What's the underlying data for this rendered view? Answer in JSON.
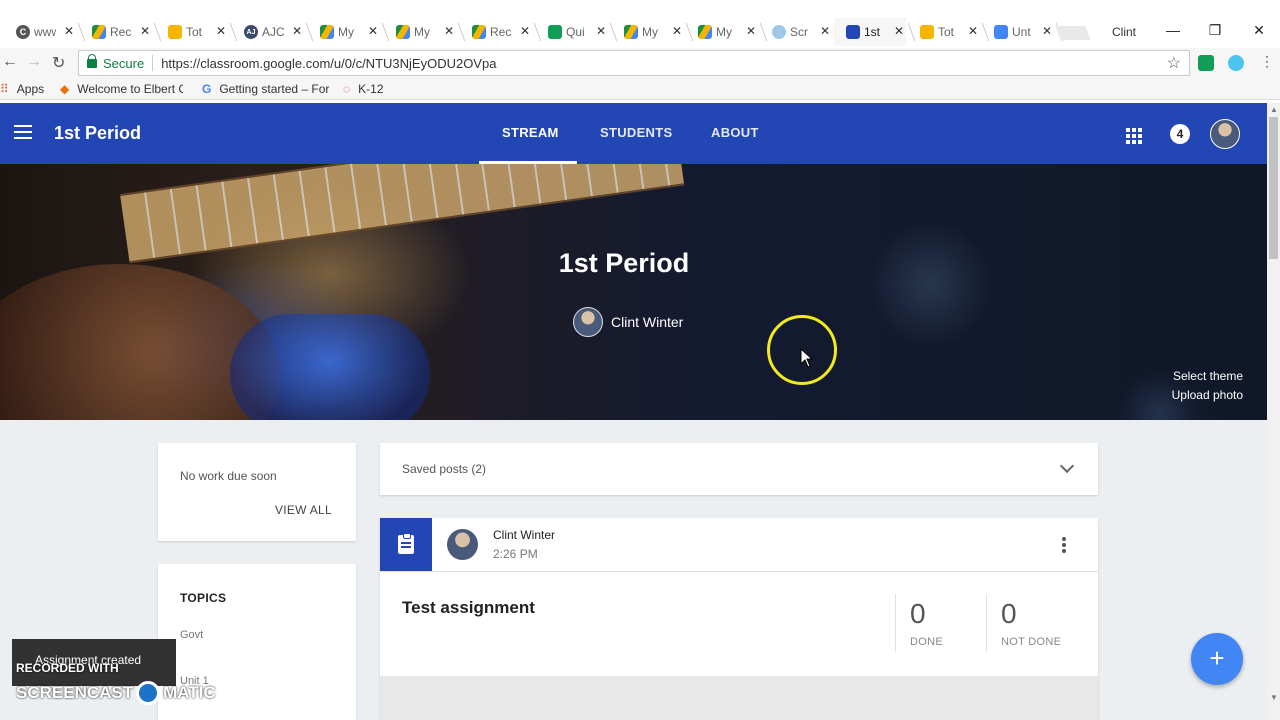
{
  "browser": {
    "tabs": [
      {
        "label": "www",
        "favicon": "C",
        "favicon_color": "#555555"
      },
      {
        "label": "Rec",
        "favicon": "",
        "favicon_color": "#1e8e3e"
      },
      {
        "label": "Tot",
        "favicon": "",
        "favicon_color": "#f4b400"
      },
      {
        "label": "AJC",
        "favicon": "AJ",
        "favicon_color": "#3c4a6b"
      },
      {
        "label": "My",
        "favicon": "",
        "favicon_color": "#1e8e3e"
      },
      {
        "label": "My",
        "favicon": "",
        "favicon_color": "#1e8e3e"
      },
      {
        "label": "Rec",
        "favicon": "",
        "favicon_color": "#1e8e3e"
      },
      {
        "label": "Qui",
        "favicon": "",
        "favicon_color": "#0f9d58"
      },
      {
        "label": "My",
        "favicon": "",
        "favicon_color": "#1e8e3e"
      },
      {
        "label": "My",
        "favicon": "",
        "favicon_color": "#1e8e3e"
      },
      {
        "label": "Scr",
        "favicon": "",
        "favicon_color": "#9fc7e8"
      },
      {
        "label": "1st",
        "favicon": "",
        "favicon_color": "#2346b5",
        "active": true
      },
      {
        "label": "Tot",
        "favicon": "",
        "favicon_color": "#f4b400"
      },
      {
        "label": "Unt",
        "favicon": "",
        "favicon_color": "#4285f4"
      }
    ],
    "profile_name": "Clint",
    "window_controls": {
      "minimize": "—",
      "restore": "❐",
      "close": "✕"
    },
    "secure_label": "Secure",
    "url": "https://classroom.google.com/u/0/c/NTU3NjEyODU2OVpa",
    "bookmarks": [
      {
        "label": "Apps",
        "icon": "apps-grid-icon"
      },
      {
        "label": "Welcome to Elbert Co",
        "icon": "bookmark-icon"
      },
      {
        "label": "Getting started – For",
        "icon": "google-icon"
      },
      {
        "label": "K-12",
        "icon": "loading-icon"
      }
    ]
  },
  "classroom": {
    "header_title": "1st Period",
    "nav_tabs": [
      {
        "label": "STREAM",
        "selected": true
      },
      {
        "label": "STUDENTS",
        "selected": false
      },
      {
        "label": "ABOUT",
        "selected": false
      }
    ],
    "notification_count": "4",
    "banner": {
      "title": "1st Period",
      "teacher": "Clint Winter",
      "select_theme": "Select theme",
      "upload_photo": "Upload photo"
    },
    "upcoming": {
      "message": "No work due soon",
      "view_all": "VIEW ALL"
    },
    "topics": {
      "title": "TOPICS",
      "items": [
        "Govt",
        "Unit 1"
      ]
    },
    "saved_posts": "Saved posts (2)",
    "post": {
      "author": "Clint Winter",
      "time": "2:26 PM",
      "title": "Test assignment",
      "done_count": "0",
      "done_label": "DONE",
      "not_done_count": "0",
      "not_done_label": "NOT DONE"
    },
    "toast": "Assignment created",
    "fab_label": "+"
  },
  "watermark": {
    "line1": "RECORDED WITH",
    "line2a": "SCREENCAST",
    "line2b": "MATIC"
  },
  "colors": {
    "appbar": "#2346b5",
    "fab": "#4285f4",
    "secure": "#0b8043",
    "cursor_highlight": "#f2ea1e"
  }
}
